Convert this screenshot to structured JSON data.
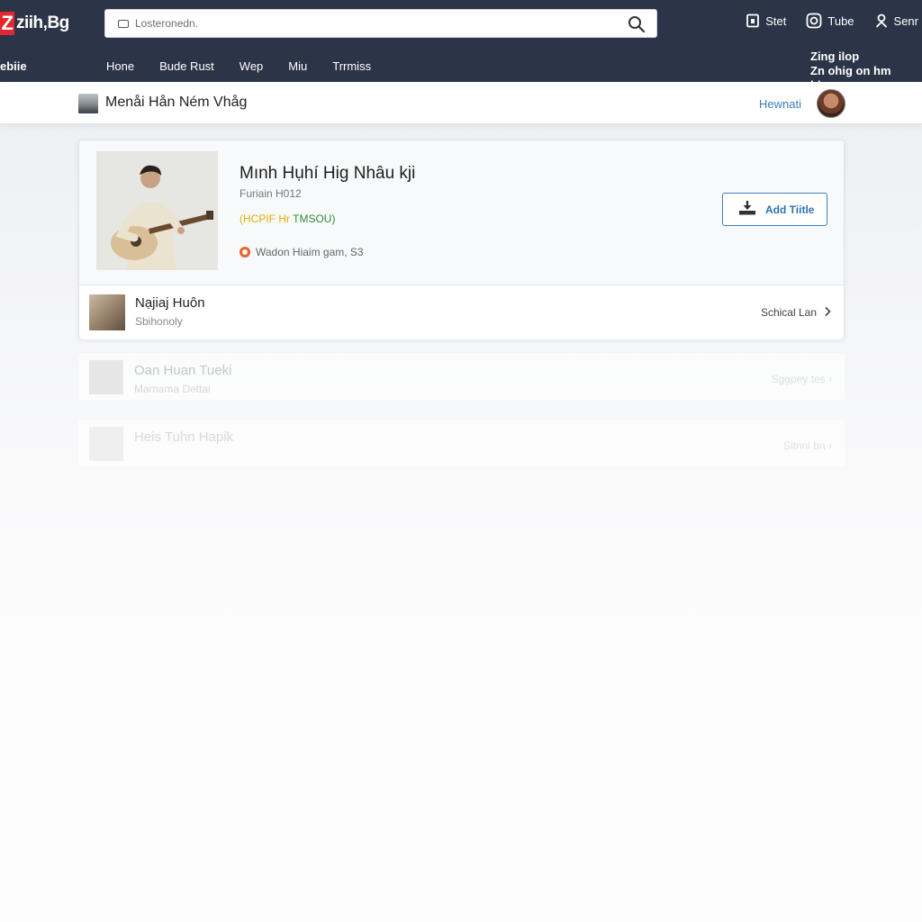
{
  "header": {
    "logo_text": "ziih,Bg",
    "logo_letter": "Z",
    "search": {
      "placeholder": "Losteronedn."
    },
    "actions": [
      {
        "label": "Stet",
        "icon": "bookmark-icon"
      },
      {
        "label": "Tube",
        "icon": "camera-icon"
      },
      {
        "label": "Senr",
        "icon": "user-icon"
      }
    ],
    "nav_left_label": "ebiie",
    "nav": [
      "Hone",
      "Bude Rust",
      "Wep",
      "Miu",
      "Trrmiss"
    ],
    "promo_line1": "Zing ilop",
    "promo_line2": "Zn ohig on hm hip"
  },
  "subheader": {
    "title": "Menåi Hån Ném Vhåg",
    "link": "Hewnati"
  },
  "card": {
    "song_title": "Mınh Hụhí Hig Nhâu kji",
    "song_sub": "Furiain H012",
    "tag_part1": "(HCPIF Hr",
    "tag_part2": "TMSOU)",
    "meta": "Wadon Hiaim gam, S3",
    "add_button": "Add Tiitle",
    "row": {
      "title": "Nạjiaj Huôn",
      "sub": "Sbihonoly",
      "action": "Schical Lan"
    }
  },
  "ghost_rows": [
    {
      "title": "Oan Huan Tueki",
      "sub": "Mamama Dettai",
      "action": "Sggpey tes"
    },
    {
      "title": "Heis Tuhn Hapik",
      "sub": "",
      "action": "Sitnnl bn"
    }
  ],
  "colors": {
    "topbar": "#2c3547",
    "logo_red": "#e3262f",
    "accent_blue": "#3d82c0",
    "tag_yellow": "#e0b000",
    "tag_green": "#2f8a3e"
  }
}
